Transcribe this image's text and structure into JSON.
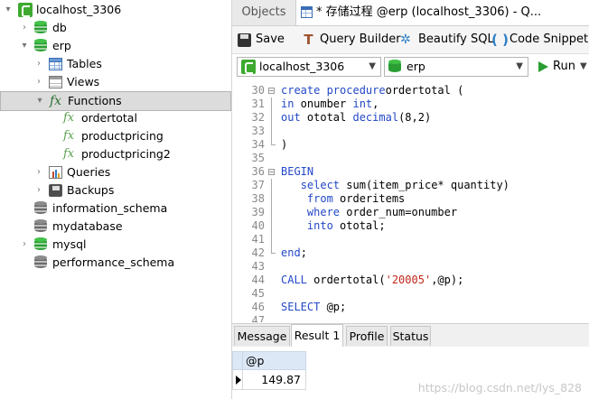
{
  "nav": {
    "items": [
      {
        "label": "localhost_3306",
        "icon": "connection-icon",
        "expanded": true
      },
      {
        "label": "db",
        "icon": "database-icon",
        "expanded": false
      },
      {
        "label": "erp",
        "icon": "database-icon",
        "expanded": true
      },
      {
        "label": "Tables",
        "icon": "table-icon"
      },
      {
        "label": "Views",
        "icon": "view-icon"
      },
      {
        "label": "Functions",
        "icon": "function-icon",
        "selected": true
      },
      {
        "label": "ordertotal",
        "icon": "function-icon"
      },
      {
        "label": "productpricing",
        "icon": "function-icon"
      },
      {
        "label": "productpricing2",
        "icon": "function-icon"
      },
      {
        "label": "Queries",
        "icon": "query-icon"
      },
      {
        "label": "Backups",
        "icon": "backup-icon"
      },
      {
        "label": "information_schema",
        "icon": "database-icon"
      },
      {
        "label": "mydatabase",
        "icon": "database-icon"
      },
      {
        "label": "mysql",
        "icon": "database-icon"
      },
      {
        "label": "performance_schema",
        "icon": "database-icon"
      }
    ]
  },
  "tabs": {
    "objects": "Objects",
    "query": "* 存储过程 @erp (localhost_3306) - Q..."
  },
  "toolbar": {
    "save": "Save",
    "query_builder": "Query Builder",
    "beautify": "Beautify SQL",
    "code_snippet": "Code Snippet"
  },
  "selectors": {
    "connection": "localhost_3306",
    "database": "erp",
    "run": "Run"
  },
  "editor": {
    "lines": [
      {
        "n": "30",
        "fold": "box",
        "t": [
          [
            "kw",
            "create procedure"
          ],
          [
            "",
            "ordertotal ("
          ]
        ]
      },
      {
        "n": "31",
        "fold": "line",
        "t": [
          [
            "kw",
            "in"
          ],
          [
            "",
            " onumber "
          ],
          [
            "kw",
            "int"
          ],
          [
            "",
            ","
          ]
        ]
      },
      {
        "n": "32",
        "fold": "line",
        "t": [
          [
            "kw",
            "out"
          ],
          [
            "",
            " ototal "
          ],
          [
            "kw",
            "decimal"
          ],
          [
            "",
            "(8,2)"
          ]
        ]
      },
      {
        "n": "33",
        "fold": "line",
        "t": []
      },
      {
        "n": "34",
        "fold": "end",
        "t": [
          [
            "",
            ")"
          ]
        ]
      },
      {
        "n": "35",
        "fold": "",
        "t": []
      },
      {
        "n": "36",
        "fold": "box",
        "t": [
          [
            "kw",
            "BEGIN"
          ]
        ]
      },
      {
        "n": "37",
        "fold": "line",
        "t": [
          [
            "",
            "   "
          ],
          [
            "kw",
            "select"
          ],
          [
            "",
            " sum(item_price* quantity)"
          ]
        ]
      },
      {
        "n": "38",
        "fold": "line",
        "t": [
          [
            "",
            "    "
          ],
          [
            "kw",
            "from"
          ],
          [
            "",
            " orderitems"
          ]
        ]
      },
      {
        "n": "39",
        "fold": "line",
        "t": [
          [
            "",
            "    "
          ],
          [
            "kw",
            "where"
          ],
          [
            "",
            " order_num=onumber"
          ]
        ]
      },
      {
        "n": "40",
        "fold": "line",
        "t": [
          [
            "",
            "    "
          ],
          [
            "kw",
            "into"
          ],
          [
            "",
            " ototal;"
          ]
        ]
      },
      {
        "n": "41",
        "fold": "line",
        "t": []
      },
      {
        "n": "42",
        "fold": "end",
        "t": [
          [
            "kw",
            "end"
          ],
          [
            "",
            ";"
          ]
        ]
      },
      {
        "n": "43",
        "fold": "",
        "t": []
      },
      {
        "n": "44",
        "fold": "",
        "t": [
          [
            "kw",
            "CALL"
          ],
          [
            "",
            " ordertotal("
          ],
          [
            "str",
            "'20005'"
          ],
          [
            "",
            ",@p);"
          ]
        ]
      },
      {
        "n": "45",
        "fold": "",
        "t": []
      },
      {
        "n": "46",
        "fold": "",
        "t": [
          [
            "kw",
            "SELECT"
          ],
          [
            "",
            " @p;"
          ]
        ]
      },
      {
        "n": "47",
        "fold": "",
        "t": []
      }
    ]
  },
  "result_tabs": [
    "Message",
    "Result 1",
    "Profile",
    "Status"
  ],
  "result_active": "Result 1",
  "grid": {
    "column": "@p",
    "value": "149.87"
  },
  "watermark": "https://blog.csdn.net/lys_828"
}
